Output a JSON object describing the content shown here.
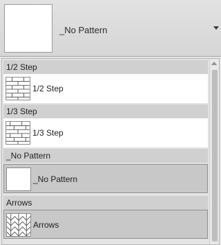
{
  "combo": {
    "value": "_No Pattern",
    "icon": "chevron-down-icon"
  },
  "list": {
    "groups": [
      {
        "header": "1/2 Step",
        "item_label": "1/2 Step",
        "pattern": "brick-half"
      },
      {
        "header": "1/3 Step",
        "item_label": "1/3 Step",
        "pattern": "brick-third"
      },
      {
        "header": "_No Pattern",
        "item_label": "_No Pattern",
        "pattern": "none",
        "selected": true
      },
      {
        "header": "Arrows",
        "item_label": "Arrows",
        "pattern": "arrows"
      }
    ]
  },
  "colors": {
    "header_bg": "#d0d0d0",
    "item_bg": "#ffffff",
    "selected_bg": "#c8c8c8"
  }
}
